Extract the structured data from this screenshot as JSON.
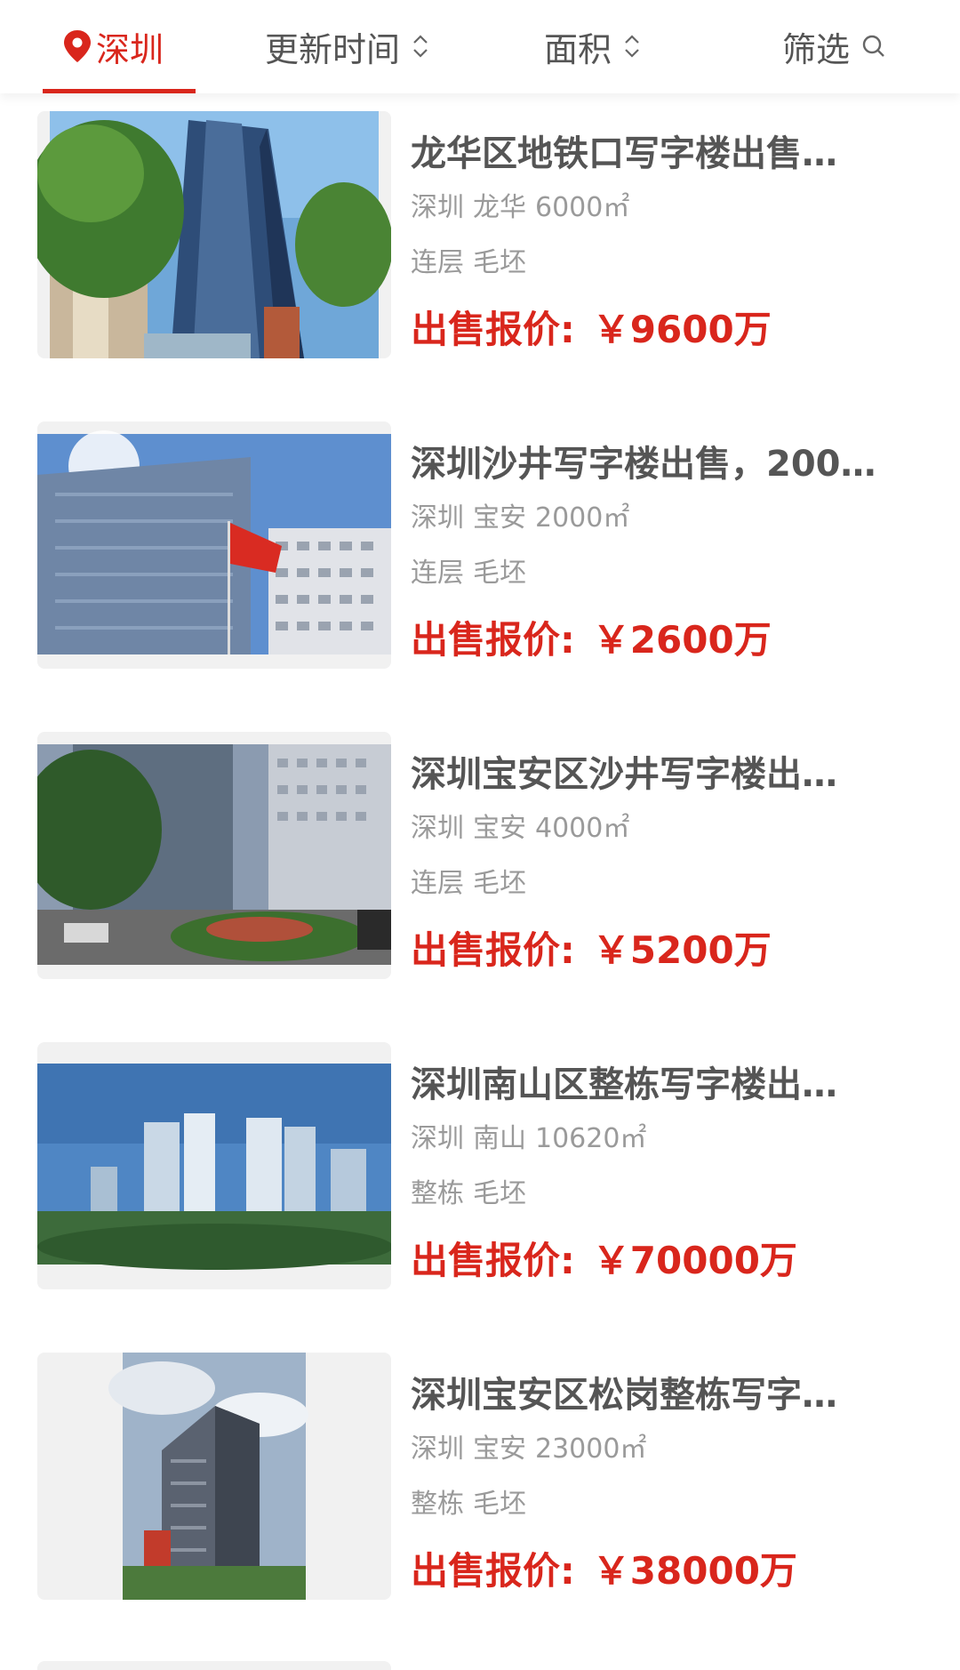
{
  "filter_bar": {
    "city": "深圳",
    "update_time": "更新时间",
    "area": "面积",
    "filter": "筛选"
  },
  "listings": [
    {
      "title": "龙华区地铁口写字楼出售…",
      "city": "深圳",
      "district": "龙华",
      "area": "6000㎡",
      "floor_type": "连层",
      "decoration": "毛坯",
      "price_label": "出售报价:",
      "price": "￥9600万",
      "image_icon": "office-tower-photo"
    },
    {
      "title": "深圳沙井写字楼出售，200…",
      "city": "深圳",
      "district": "宝安",
      "area": "2000㎡",
      "floor_type": "连层",
      "decoration": "毛坯",
      "price_label": "出售报价:",
      "price": "￥2600万",
      "image_icon": "office-building-flag-photo"
    },
    {
      "title": "深圳宝安区沙井写字楼出…",
      "city": "深圳",
      "district": "宝安",
      "area": "4000㎡",
      "floor_type": "连层",
      "decoration": "毛坯",
      "price_label": "出售报价:",
      "price": "￥5200万",
      "image_icon": "street-view-photo"
    },
    {
      "title": "深圳南山区整栋写字楼出…",
      "city": "深圳",
      "district": "南山",
      "area": "10620㎡",
      "floor_type": "整栋",
      "decoration": "毛坯",
      "price_label": "出售报价:",
      "price": "￥70000万",
      "image_icon": "complex-rendering-photo"
    },
    {
      "title": "深圳宝安区松岗整栋写字…",
      "city": "深圳",
      "district": "宝安",
      "area": "23000㎡",
      "floor_type": "整栋",
      "decoration": "毛坯",
      "price_label": "出售报价:",
      "price": "￥38000万",
      "image_icon": "tall-building-photo"
    }
  ],
  "colors": {
    "accent": "#d9261c",
    "title": "#555555",
    "meta": "#9a9a9a"
  }
}
